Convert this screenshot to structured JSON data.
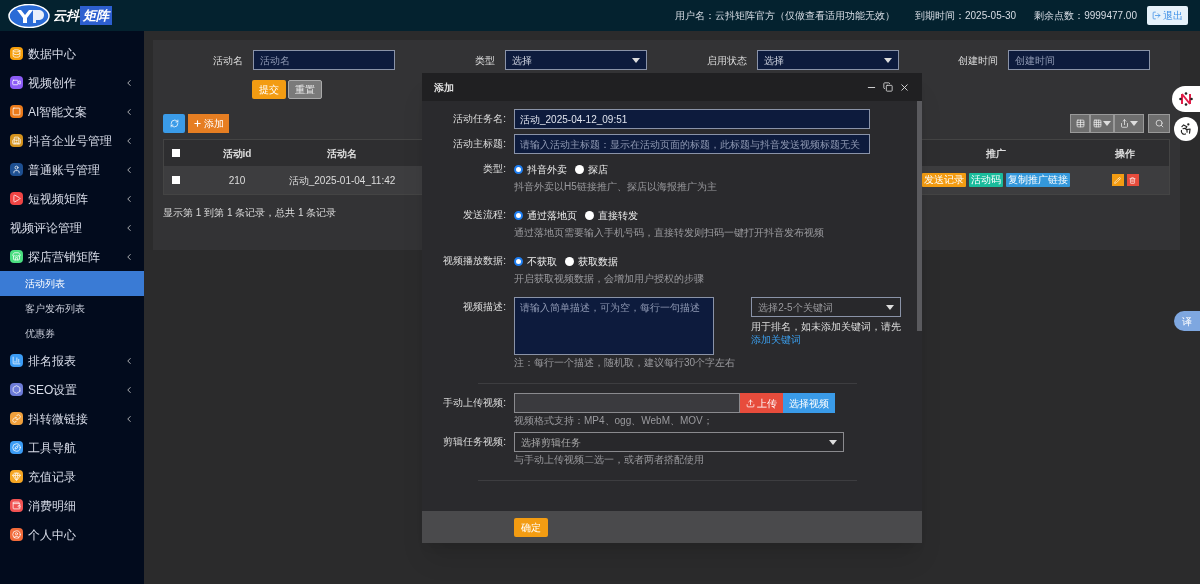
{
  "header": {
    "logo_text_1": "云抖",
    "logo_text_2": "矩阵",
    "user": "用户名：云抖矩阵官方（仅做查看适用功能无效）",
    "expiry": "到期时间：2025-05-30",
    "points": "剩余点数：9999477.00",
    "logout": "退出"
  },
  "sidebar": {
    "items": [
      {
        "label": "数据中心",
        "color": "#f59e0b",
        "has_submenu": false
      },
      {
        "label": "视频创作",
        "color": "#8b5cf6",
        "has_submenu": true
      },
      {
        "label": "AI智能文案",
        "color": "#ea7a1a",
        "has_submenu": true
      },
      {
        "label": "抖音企业号管理",
        "color": "#d4921c",
        "has_submenu": true
      },
      {
        "label": "普通账号管理",
        "color": "#1d4f91",
        "has_submenu": true
      },
      {
        "label": "短视频矩阵",
        "color": "#ef4444",
        "has_submenu": true
      },
      {
        "label": "视频评论管理",
        "has_submenu": true
      },
      {
        "label": "探店营销矩阵",
        "color": "#4ade80",
        "has_submenu": true,
        "children": [
          {
            "label": "活动列表",
            "selected": true
          },
          {
            "label": "客户发布列表",
            "selected": false
          },
          {
            "label": "优惠券",
            "selected": false
          }
        ]
      },
      {
        "label": "排名报表",
        "color": "#3b9cf5",
        "has_submenu": true
      },
      {
        "label": "SEO设置",
        "color": "#6c7bd8",
        "has_submenu": true
      },
      {
        "label": "抖转微链接",
        "color": "#f0a03c",
        "has_submenu": true
      },
      {
        "label": "工具导航",
        "color": "#3b9cf5",
        "has_submenu": false
      },
      {
        "label": "充值记录",
        "color": "#f5a623",
        "has_submenu": false
      },
      {
        "label": "消费明细",
        "color": "#f05252",
        "has_submenu": false
      },
      {
        "label": "个人中心",
        "color": "#f26b3a",
        "has_submenu": false
      }
    ]
  },
  "filters": [
    {
      "kind": "input",
      "label": "活动名",
      "placeholder": "活动名"
    },
    {
      "kind": "select",
      "label": "类型",
      "value": "选择"
    },
    {
      "kind": "select",
      "label": "启用状态",
      "value": "选择"
    },
    {
      "kind": "input",
      "label": "创建时间",
      "placeholder": "创建时间"
    }
  ],
  "filter_buttons": {
    "submit": "提交",
    "reset": "重置"
  },
  "toolbar": {
    "add": "添加"
  },
  "table": {
    "columns": [
      "活动id",
      "活动名",
      "推广",
      "操作"
    ],
    "rows": [
      {
        "checked": false,
        "id": "210",
        "name": "活动_2025-01-04_11:42",
        "tags": [
          {
            "label": "发送记录",
            "color": "#f39c12"
          },
          {
            "label": "活动码",
            "color": "#1abc9c"
          },
          {
            "label": "复制推广链接",
            "color": "#3498db"
          }
        ]
      }
    ]
  },
  "header_checked": false,
  "pagination": "显示第 1 到第 1 条记录，总共 1 条记录",
  "translate_tab": "译",
  "modal": {
    "title": "添加",
    "fields": [
      {
        "kind": "text",
        "label": "活动任务名:",
        "value": "活动_2025-04-12_09:51"
      },
      {
        "kind": "text",
        "label": "活动主标题:",
        "placeholder": "请输入活动主标题：显示在活动页面的标题，此标题与抖音发送视频标题无关"
      },
      {
        "kind": "radio",
        "label": "类型:",
        "options": [
          {
            "label": "抖音外卖",
            "selected": true
          },
          {
            "label": "探店",
            "selected": false
          }
        ],
        "help": "抖音外卖以H5链接推广、探店以海报推广为主"
      },
      {
        "kind": "radio",
        "label": "发送流程:",
        "options": [
          {
            "label": "通过落地页",
            "selected": true
          },
          {
            "label": "直接转发",
            "selected": false
          }
        ],
        "help": "通过落地页需要输入手机号码，直接转发则扫码一键打开抖音发布视频"
      },
      {
        "kind": "radio",
        "label": "视频播放数据:",
        "options": [
          {
            "label": "不获取",
            "selected": true
          },
          {
            "label": "获取数据",
            "selected": false
          }
        ],
        "help": "开启获取视频数据，会增加用户授权的步骤"
      },
      {
        "kind": "textarea",
        "label": "视频描述:",
        "placeholder": "请输入简单描述，可为空，每行一句描述",
        "help": "注：每行一个描述，随机取，建议每行30个字左右",
        "keyword_select": "选择2-5个关键词",
        "keyword_help": "用于排名，如未添加关键词，请先",
        "keyword_link": "添加关键词"
      },
      {
        "kind": "divider"
      },
      {
        "kind": "upload",
        "label": "手动上传视频:",
        "upload_button": "上传",
        "choose_button": "选择视频",
        "help": "视频格式支持：MP4、ogg、WebM、MOV；"
      },
      {
        "kind": "select",
        "label": "剪辑任务视频:",
        "value": "选择剪辑任务",
        "help": "与手动上传视频二选一，或者两者搭配使用"
      },
      {
        "kind": "divider"
      }
    ],
    "confirm": "确定"
  }
}
